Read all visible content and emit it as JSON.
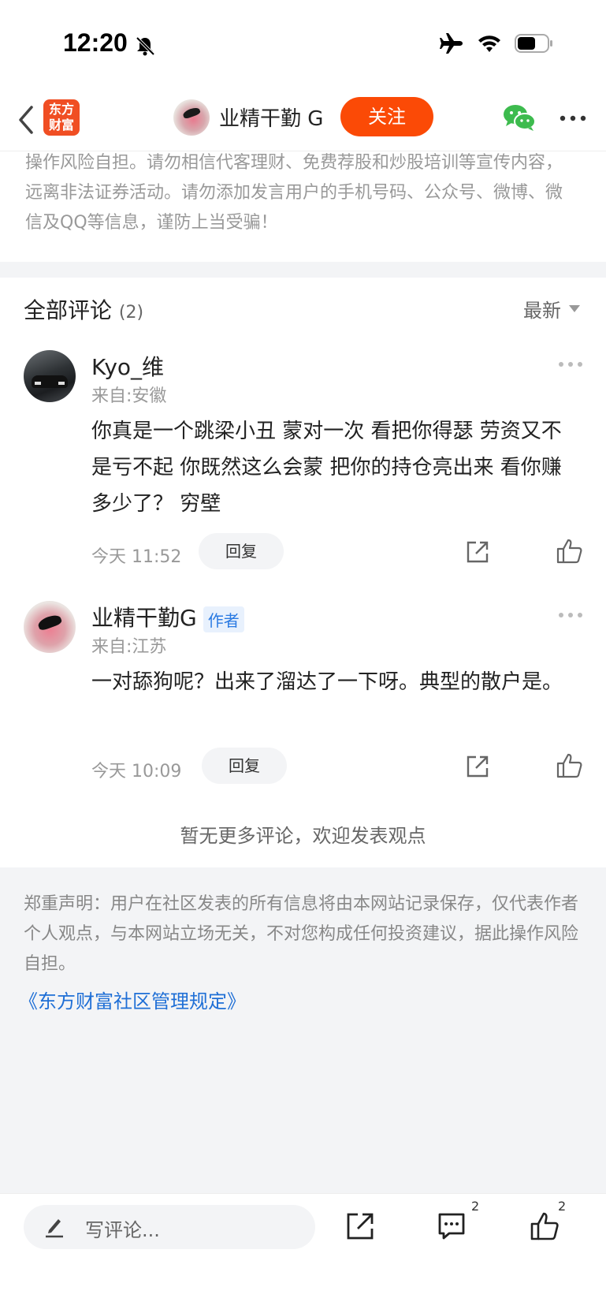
{
  "status_bar": {
    "time": "12:20"
  },
  "nav": {
    "logo_line1": "东方",
    "logo_line2": "财富",
    "username": "业精干勤 G",
    "follow_label": "关注"
  },
  "top_disclaimer": "操作风险自担。请勿相信代客理财、免费荐股和炒股培训等宣传内容，远离非法证券活动。请勿添加发言用户的手机号码、公众号、微博、微信及QQ等信息，谨防上当受骗！",
  "comments_header": {
    "title": "全部评论",
    "count": "(2)",
    "sort_label": "最新"
  },
  "comments": [
    {
      "name": "Kyo_维",
      "location": "来自:安徽",
      "body": "你真是一个跳梁小丑 蒙对一次 看把你得瑟 劳资又不是亏不起 你既然这么会蒙 把你的持仓亮出来 看你赚多少了？ 穷壁",
      "time": "今天 11:52",
      "reply_label": "回复"
    },
    {
      "name": "业精干勤G",
      "badge": "作者",
      "location": "来自:江苏",
      "body": "一对舔狗呢？出来了溜达了一下呀。典型的散户是。",
      "time": "今天 10:09",
      "reply_label": "回复"
    }
  ],
  "no_more_text": "暂无更多评论，欢迎发表观点",
  "bottom_disclaimer": "郑重声明：用户在社区发表的所有信息将由本网站记录保存，仅代表作者个人观点，与本网站立场无关，不对您构成任何投资建议，据此操作风险自担。",
  "rules_link": "《东方财富社区管理规定》",
  "bottom_bar": {
    "placeholder": "写评论...",
    "comment_count": "2",
    "like_count": "2"
  },
  "colors": {
    "accent": "#fb4a06",
    "link": "#1f6fd6",
    "wechat": "#3dbb4e"
  }
}
